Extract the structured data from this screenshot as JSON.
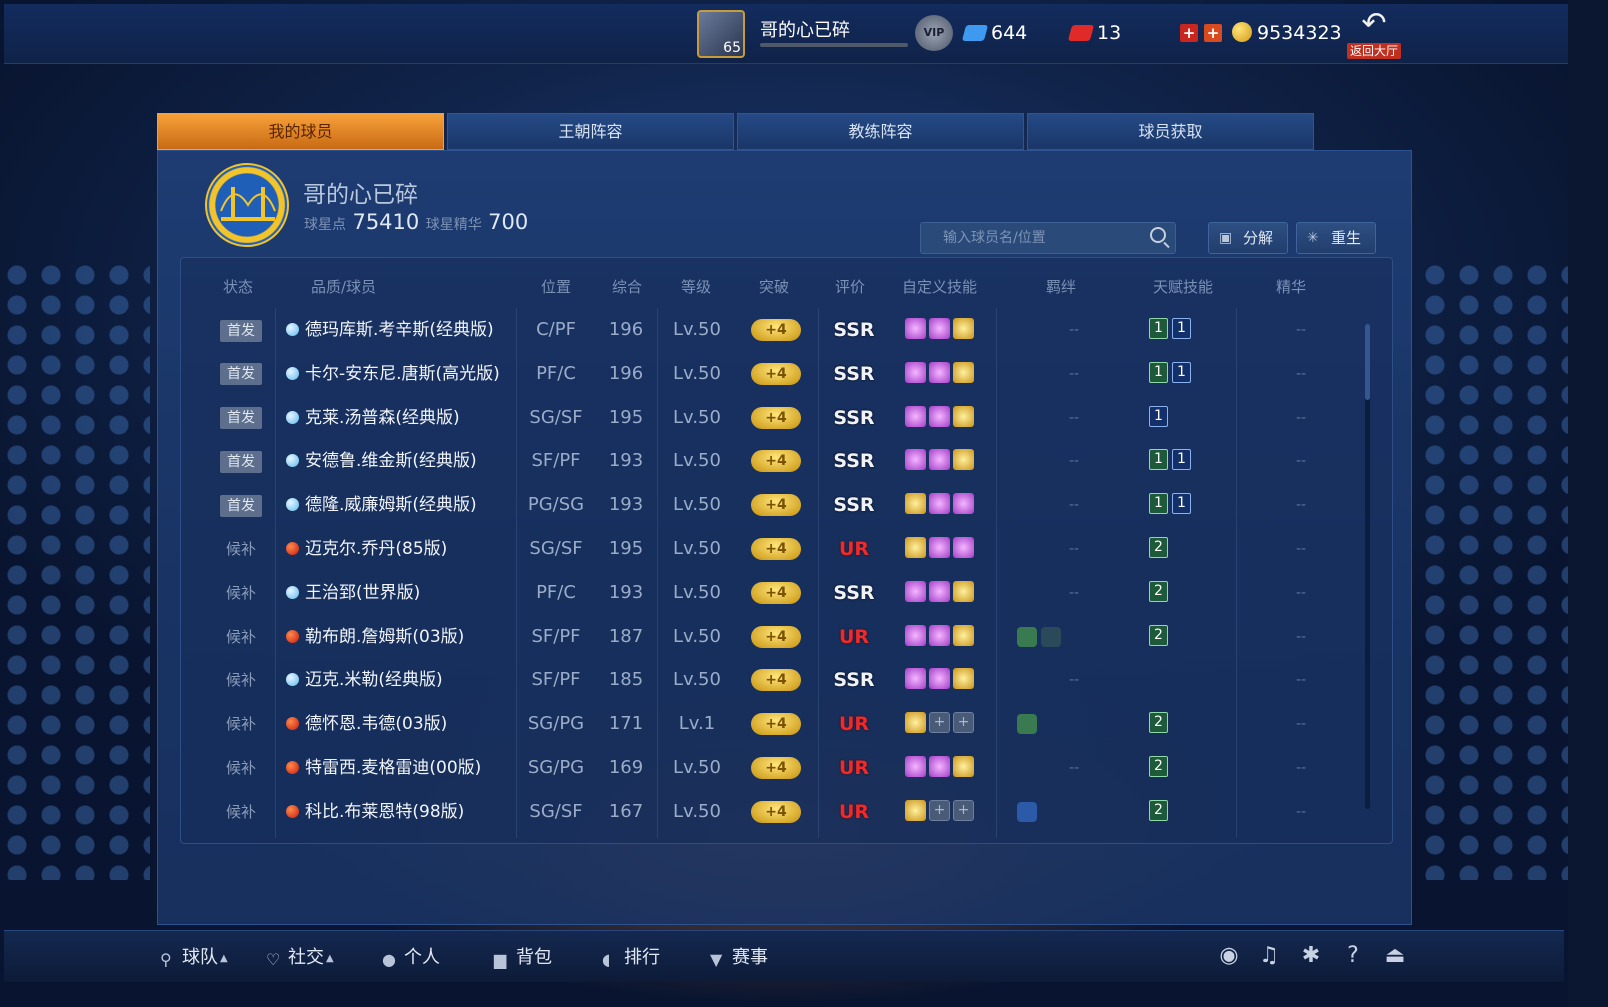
{
  "header": {
    "username": "哥的心已碎",
    "level": "65",
    "vip_label": "VIP",
    "diamonds": "644",
    "tickets": "13",
    "coins": "9534323",
    "back_label": "返回大厅"
  },
  "tabs": [
    {
      "label": "我的球员",
      "active": true
    },
    {
      "label": "王朝阵容",
      "active": false
    },
    {
      "label": "教练阵容",
      "active": false
    },
    {
      "label": "球员获取",
      "active": false
    }
  ],
  "team": {
    "name": "哥的心已碎",
    "star_points_label": "球星点",
    "star_points": "75410",
    "essence_label": "球星精华",
    "essence": "700"
  },
  "search": {
    "placeholder": "输入球员名/位置"
  },
  "actions": {
    "decompose": "分解",
    "rebirth": "重生"
  },
  "columns": [
    "状态",
    "品质/球员",
    "位置",
    "综合",
    "等级",
    "突破",
    "评价",
    "自定义技能",
    "羁绊",
    "天赋技能",
    "精华"
  ],
  "players": [
    {
      "status": "首发",
      "starter": true,
      "quality": "blue",
      "name": "德玛库斯.考辛斯(经典版)",
      "pos": "C/PF",
      "ovr": "196",
      "lv": "Lv.50",
      "brk": "+4",
      "grade": "SSR",
      "skills": [
        "p",
        "p",
        "g"
      ],
      "bond": "--",
      "bonds": [],
      "talents": [
        {
          "v": "1",
          "t": "a"
        },
        {
          "v": "1",
          "t": "b"
        }
      ],
      "ess": "--"
    },
    {
      "status": "首发",
      "starter": true,
      "quality": "blue",
      "name": "卡尔-安东尼.唐斯(高光版)",
      "pos": "PF/C",
      "ovr": "196",
      "lv": "Lv.50",
      "brk": "+4",
      "grade": "SSR",
      "skills": [
        "p",
        "p",
        "g"
      ],
      "bond": "--",
      "bonds": [],
      "talents": [
        {
          "v": "1",
          "t": "a"
        },
        {
          "v": "1",
          "t": "b"
        }
      ],
      "ess": "--"
    },
    {
      "status": "首发",
      "starter": true,
      "quality": "blue",
      "name": "克莱.汤普森(经典版)",
      "pos": "SG/SF",
      "ovr": "195",
      "lv": "Lv.50",
      "brk": "+4",
      "grade": "SSR",
      "skills": [
        "p",
        "p",
        "g"
      ],
      "bond": "--",
      "bonds": [],
      "talents": [
        {
          "v": "1",
          "t": "b"
        }
      ],
      "ess": "--"
    },
    {
      "status": "首发",
      "starter": true,
      "quality": "blue",
      "name": "安德鲁.维金斯(经典版)",
      "pos": "SF/PF",
      "ovr": "193",
      "lv": "Lv.50",
      "brk": "+4",
      "grade": "SSR",
      "skills": [
        "p",
        "p",
        "g"
      ],
      "bond": "--",
      "bonds": [],
      "talents": [
        {
          "v": "1",
          "t": "a"
        },
        {
          "v": "1",
          "t": "b"
        }
      ],
      "ess": "--"
    },
    {
      "status": "首发",
      "starter": true,
      "quality": "blue",
      "name": "德隆.威廉姆斯(经典版)",
      "pos": "PG/SG",
      "ovr": "193",
      "lv": "Lv.50",
      "brk": "+4",
      "grade": "SSR",
      "skills": [
        "g",
        "p",
        "p"
      ],
      "bond": "--",
      "bonds": [],
      "talents": [
        {
          "v": "1",
          "t": "a"
        },
        {
          "v": "1",
          "t": "b"
        }
      ],
      "ess": "--"
    },
    {
      "status": "候补",
      "starter": false,
      "quality": "red",
      "name": "迈克尔.乔丹(85版)",
      "pos": "SG/SF",
      "ovr": "195",
      "lv": "Lv.50",
      "brk": "+4",
      "grade": "UR",
      "skills": [
        "g",
        "p",
        "p"
      ],
      "bond": "--",
      "bonds": [],
      "talents": [
        {
          "v": "2",
          "t": "a"
        }
      ],
      "ess": "--"
    },
    {
      "status": "候补",
      "starter": false,
      "quality": "blue",
      "name": "王治郅(世界版)",
      "pos": "PF/C",
      "ovr": "193",
      "lv": "Lv.50",
      "brk": "+4",
      "grade": "SSR",
      "skills": [
        "p",
        "p",
        "g"
      ],
      "bond": "--",
      "bonds": [],
      "talents": [
        {
          "v": "2",
          "t": "a"
        }
      ],
      "ess": "--"
    },
    {
      "status": "候补",
      "starter": false,
      "quality": "red",
      "name": "勒布朗.詹姆斯(03版)",
      "pos": "SF/PF",
      "ovr": "187",
      "lv": "Lv.50",
      "brk": "+4",
      "grade": "UR",
      "skills": [
        "p",
        "p",
        "g"
      ],
      "bond": "",
      "bonds": [
        "green",
        "dim"
      ],
      "talents": [
        {
          "v": "2",
          "t": "a"
        }
      ],
      "ess": "--"
    },
    {
      "status": "候补",
      "starter": false,
      "quality": "blue",
      "name": "迈克.米勒(经典版)",
      "pos": "SF/PF",
      "ovr": "185",
      "lv": "Lv.50",
      "brk": "+4",
      "grade": "SSR",
      "skills": [
        "p",
        "p",
        "g"
      ],
      "bond": "--",
      "bonds": [],
      "talents": [],
      "ess": "--"
    },
    {
      "status": "候补",
      "starter": false,
      "quality": "red",
      "name": "德怀恩.韦德(03版)",
      "pos": "SG/PG",
      "ovr": "171",
      "lv": "Lv.1",
      "brk": "+4",
      "grade": "UR",
      "skills": [
        "g",
        "e",
        "e"
      ],
      "bond": "",
      "bonds": [
        "green"
      ],
      "talents": [
        {
          "v": "2",
          "t": "a"
        }
      ],
      "ess": "--"
    },
    {
      "status": "候补",
      "starter": false,
      "quality": "red",
      "name": "特雷西.麦格雷迪(00版)",
      "pos": "SG/PG",
      "ovr": "169",
      "lv": "Lv.50",
      "brk": "+4",
      "grade": "UR",
      "skills": [
        "p",
        "p",
        "g"
      ],
      "bond": "--",
      "bonds": [],
      "talents": [
        {
          "v": "2",
          "t": "a"
        }
      ],
      "ess": "--"
    },
    {
      "status": "候补",
      "starter": false,
      "quality": "red",
      "name": "科比.布莱恩特(98版)",
      "pos": "SG/SF",
      "ovr": "167",
      "lv": "Lv.50",
      "brk": "+4",
      "grade": "UR",
      "skills": [
        "g",
        "e",
        "e"
      ],
      "bond": "",
      "bonds": [
        "blue"
      ],
      "talents": [
        {
          "v": "2",
          "t": "a"
        }
      ],
      "ess": "--"
    }
  ],
  "bottom_nav": [
    {
      "label": "球队",
      "icon": "person-icon",
      "caret": true
    },
    {
      "label": "社交",
      "icon": "heart-shield-icon",
      "caret": true
    },
    {
      "label": "个人",
      "icon": "user-icon",
      "caret": false
    },
    {
      "label": "背包",
      "icon": "bag-icon",
      "caret": false
    },
    {
      "label": "排行",
      "icon": "ranking-icon",
      "caret": false
    },
    {
      "label": "赛事",
      "icon": "trophy-icon",
      "caret": false
    }
  ],
  "colors": {
    "accent_orange": "#f7a13a",
    "ur_red": "#ee2a2a",
    "panel_blue": "#193465"
  }
}
